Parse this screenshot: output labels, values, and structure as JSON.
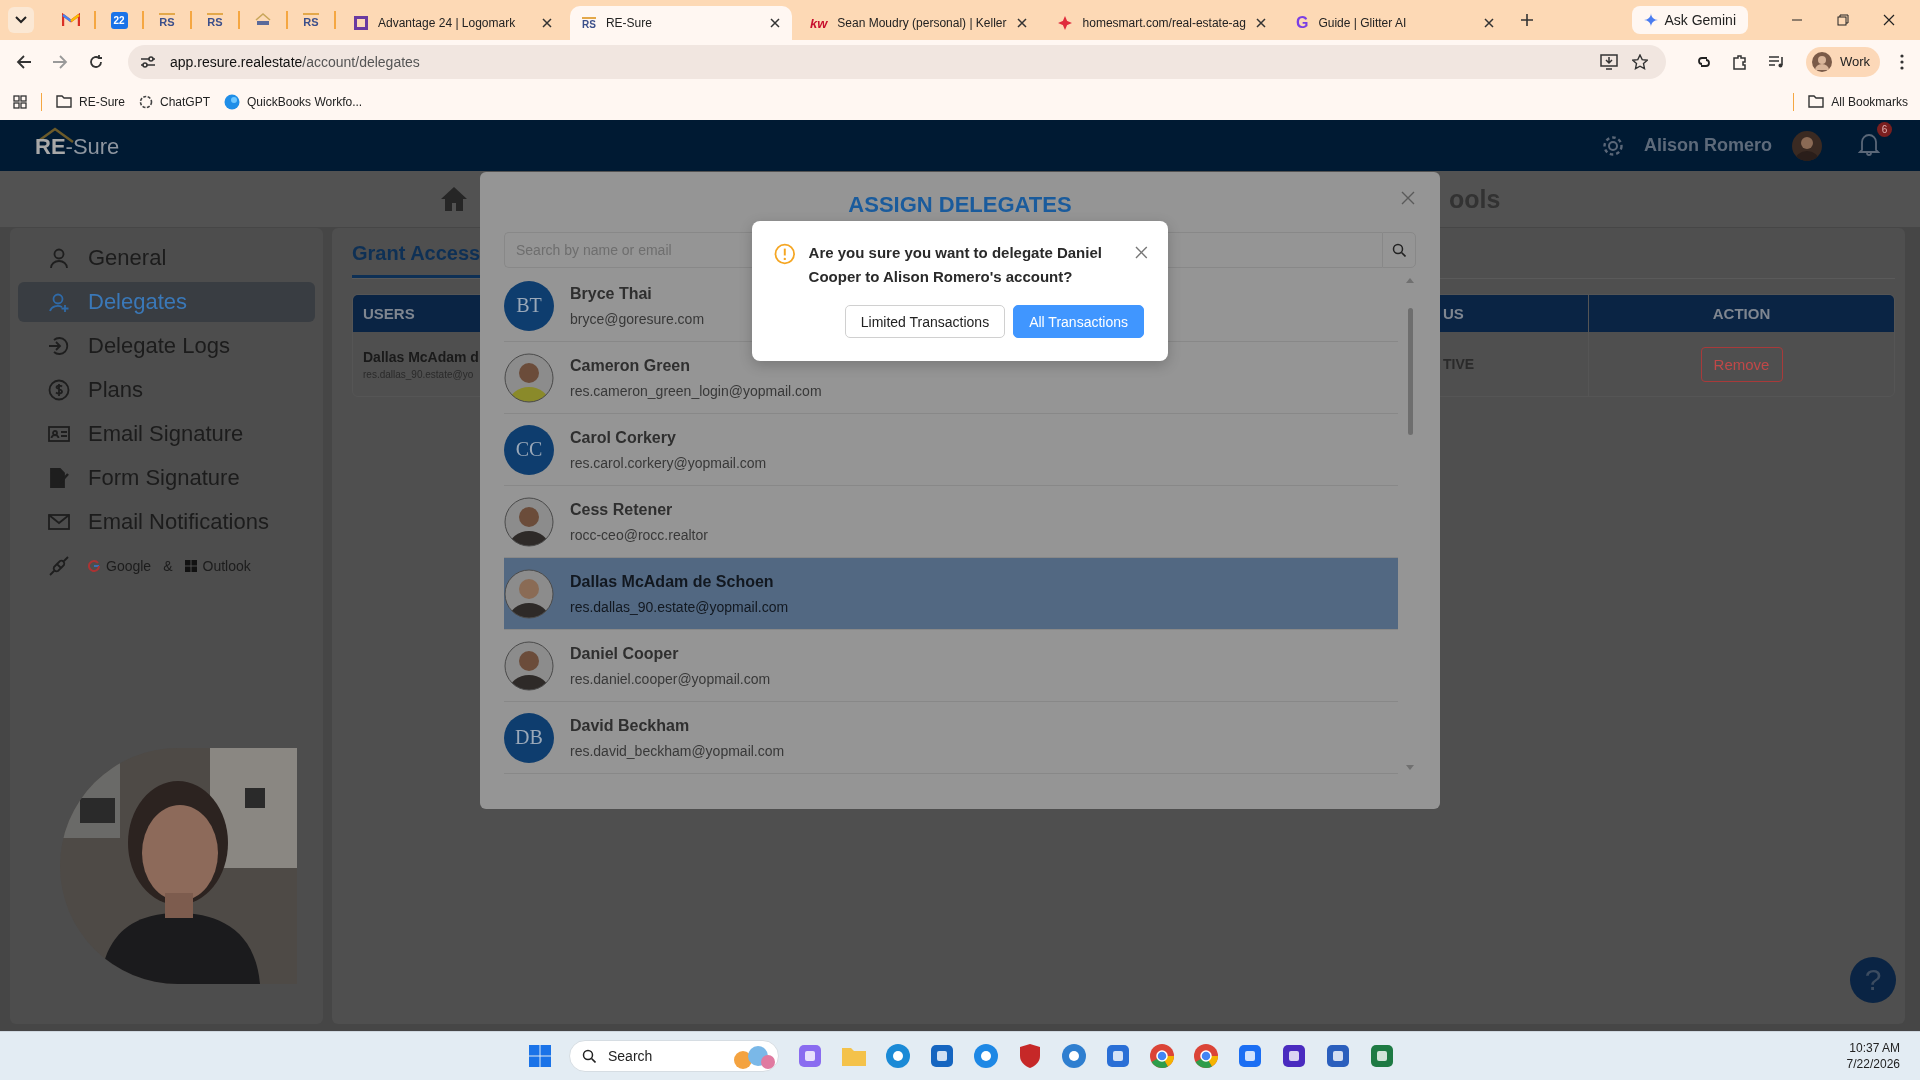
{
  "browser": {
    "pinned": [
      {
        "kind": "mail"
      },
      {
        "kind": "calendar",
        "label": "22"
      },
      {
        "kind": "rs",
        "label": "RS"
      },
      {
        "kind": "rs",
        "label": "RS"
      },
      {
        "kind": "rs_small"
      },
      {
        "kind": "rs",
        "label": "RS"
      }
    ],
    "tabs": [
      {
        "title": "Advantage 24 | Logomark",
        "selected": false
      },
      {
        "title": "RE-Sure",
        "icon_text": "RS",
        "selected": true
      },
      {
        "title": "Sean Moudry (personal) | Keller",
        "icon_text": "kw",
        "selected": false
      },
      {
        "title": "homesmart.com/real-estate-ag",
        "selected": false
      },
      {
        "title": "Guide | Glitter AI",
        "icon_text": "G",
        "selected": false
      }
    ],
    "gemini": "Ask Gemini",
    "url_host": "app.resure.realestate",
    "url_path": "/account/delegates",
    "profile": "Work",
    "bookmarks": [
      {
        "kind": "folder",
        "label": "RE-Sure"
      },
      {
        "kind": "chatgpt",
        "label": "ChatGPT"
      },
      {
        "kind": "quickbooks",
        "label": "QuickBooks Workfo..."
      }
    ],
    "all_bookmarks": "All Bookmarks"
  },
  "header": {
    "logo": "**RE**-Sure",
    "user": "Alison Romero",
    "notifications": "6"
  },
  "nav": {
    "partial_title": "ools"
  },
  "sidebar": {
    "items": [
      {
        "kind": "person",
        "label": "General",
        "selected": false
      },
      {
        "kind": "delegates",
        "label": "Delegates",
        "selected": true
      },
      {
        "kind": "logs",
        "label": "Delegate Logs",
        "selected": false
      },
      {
        "kind": "dollar",
        "label": "Plans",
        "selected": false
      },
      {
        "kind": "card",
        "label": "Email Signature",
        "selected": false
      },
      {
        "kind": "sign",
        "label": "Form Signature",
        "selected": false
      },
      {
        "kind": "mail",
        "label": "Email Notifications",
        "selected": false
      }
    ],
    "integration": {
      "google": "Google",
      "amp": "&",
      "outlook": "Outlook"
    }
  },
  "grant_access": {
    "title": "Grant Access",
    "columns": [
      "USERS",
      "US",
      "ACTION"
    ],
    "rows": [
      {
        "name": "Dallas McAdam d",
        "email": "res.dallas_90.estate@yo",
        "status": "TIVE",
        "action": "Remove"
      }
    ]
  },
  "modal": {
    "title": "ASSIGN DELEGATES",
    "search_placeholder": "Search by name or email",
    "delegates": [
      {
        "name": "Bryce Thai",
        "email": "bryce@goresure.com",
        "initials": "BT",
        "selected": false
      },
      {
        "name": "Cameron Green",
        "email": "res.cameron_green_login@yopmail.com",
        "selected": false
      },
      {
        "name": "Carol Corkery",
        "email": "res.carol.corkery@yopmail.com",
        "initials": "CC",
        "selected": false
      },
      {
        "name": "Cess Retener",
        "email": "rocc-ceo@rocc.realtor",
        "selected": false
      },
      {
        "name": "Dallas McAdam de Schoen",
        "email": "res.dallas_90.estate@yopmail.com",
        "selected": true
      },
      {
        "name": "Daniel Cooper",
        "email": "res.daniel.cooper@yopmail.com",
        "selected": false
      },
      {
        "name": "David Beckham",
        "email": "res.david_beckham@yopmail.com",
        "initials": "DB",
        "selected": false
      }
    ]
  },
  "dialog": {
    "message": "Are you sure you want to delegate Daniel Cooper to Alison Romero's account?",
    "buttons": [
      {
        "label": "Limited Transactions",
        "primary": false
      },
      {
        "label": "All Transactions",
        "primary": true
      }
    ]
  },
  "help": "?",
  "taskbar": {
    "search": "Search",
    "time": "10:37 AM",
    "date": "7/22/2026"
  }
}
